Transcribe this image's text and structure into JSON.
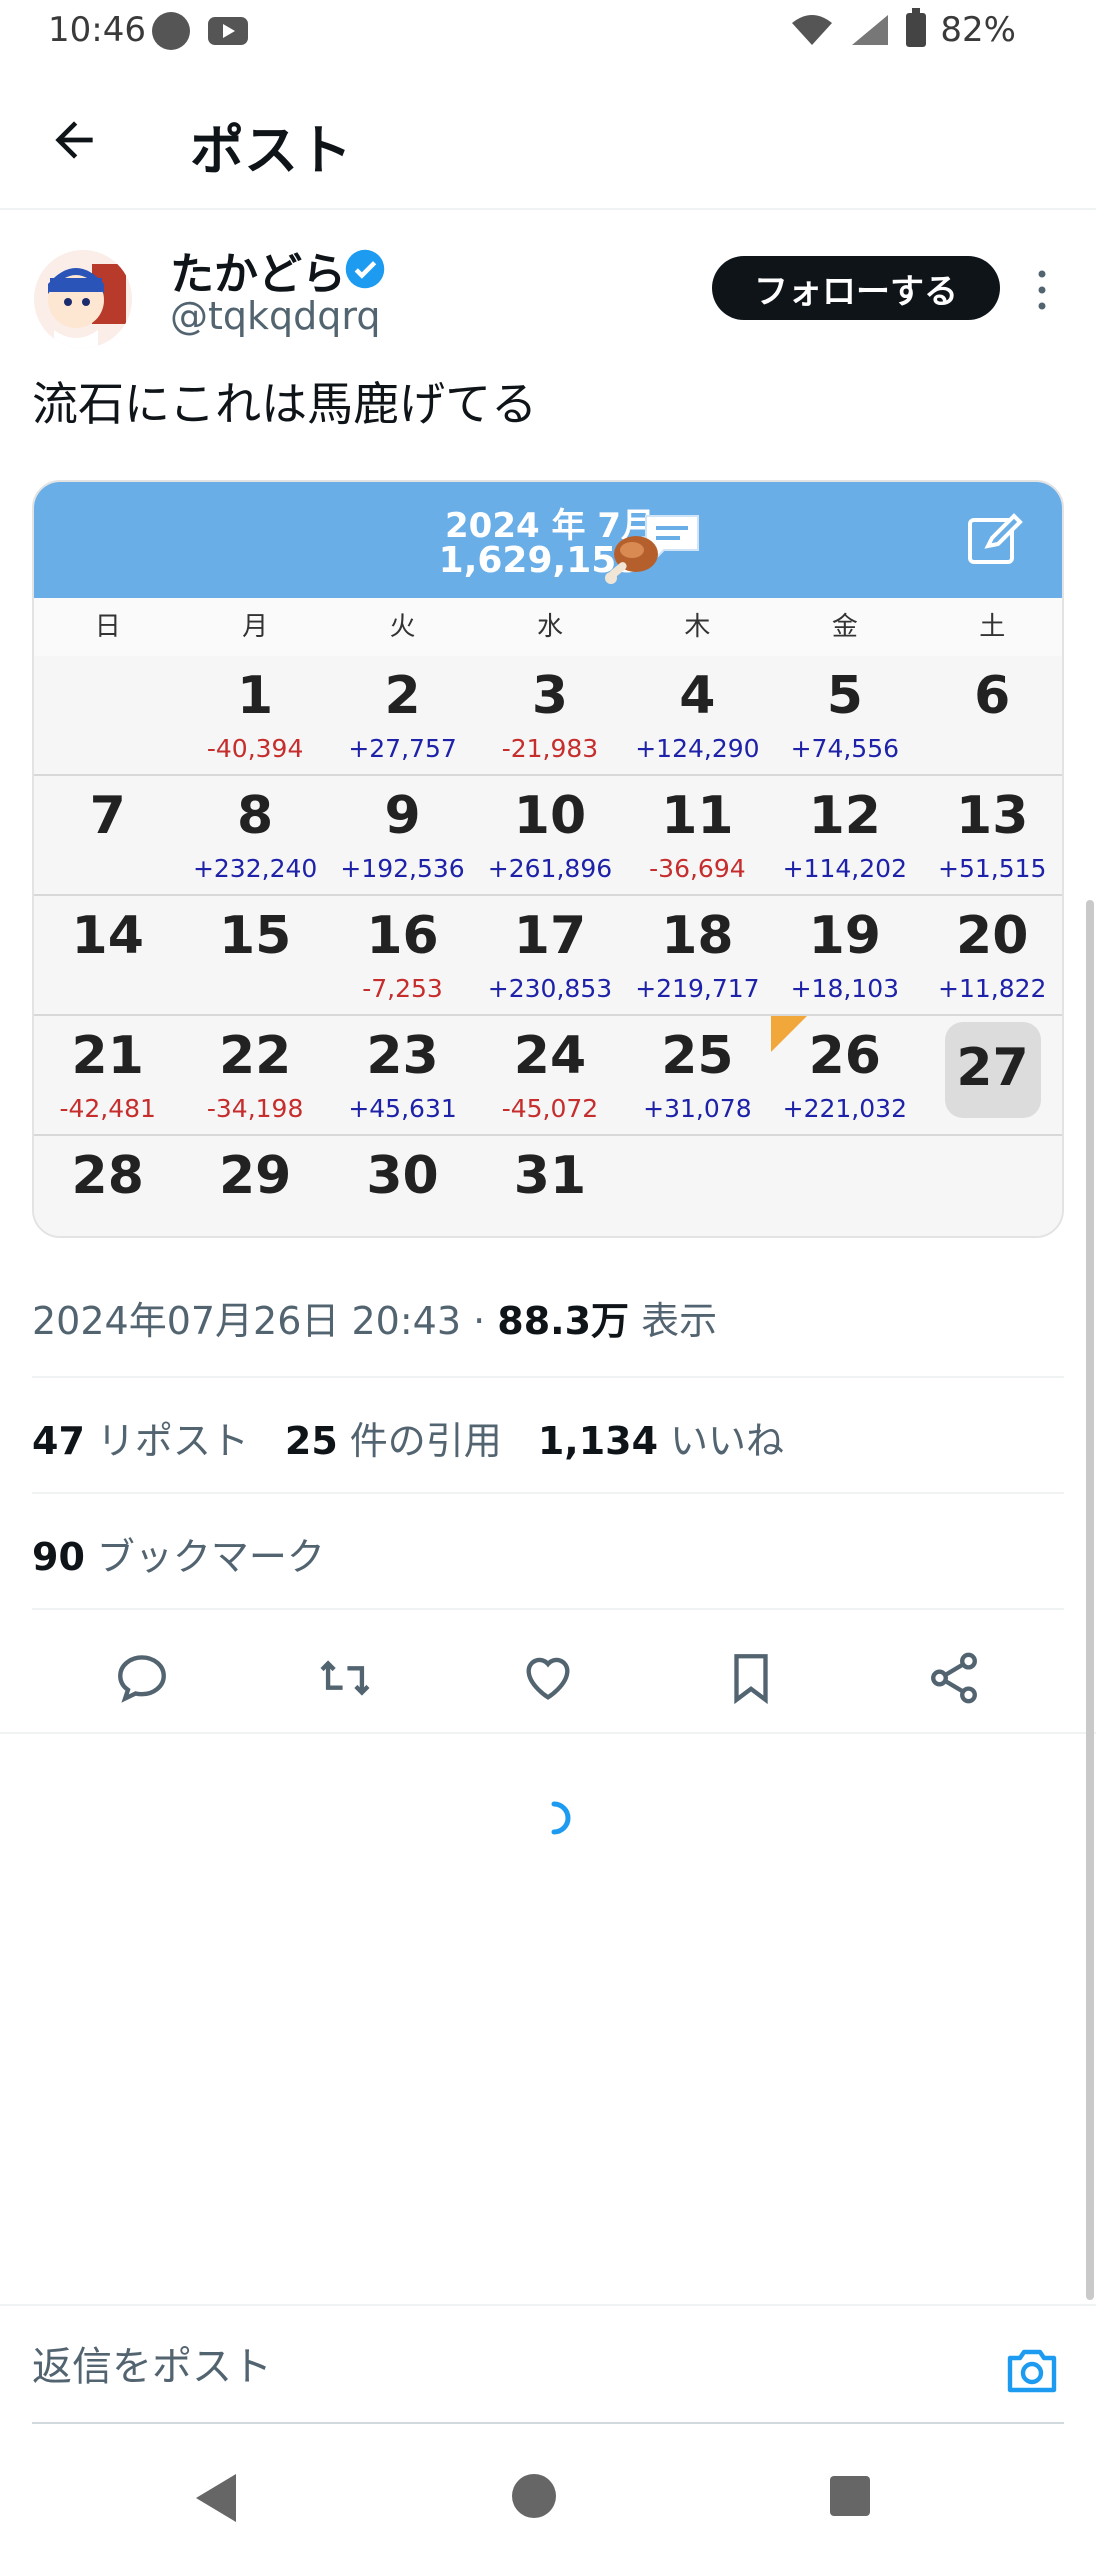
{
  "status_bar": {
    "time": "10:46",
    "battery": "82%"
  },
  "header": {
    "title": "ポスト"
  },
  "author": {
    "name": "たかどら",
    "handle": "@tqkqdqrq",
    "follow_label": "フォローする"
  },
  "post": {
    "text": "流石にこれは馬鹿げてる"
  },
  "calendar": {
    "title": "2024 年 7月",
    "total": "1,629,153",
    "weekdays": [
      "日",
      "月",
      "火",
      "水",
      "木",
      "金",
      "土"
    ],
    "weeks": [
      [
        {
          "day": "",
          "delta": ""
        },
        {
          "day": "1",
          "delta": "-40,394"
        },
        {
          "day": "2",
          "delta": "+27,757"
        },
        {
          "day": "3",
          "delta": "-21,983"
        },
        {
          "day": "4",
          "delta": "+124,290"
        },
        {
          "day": "5",
          "delta": "+74,556"
        },
        {
          "day": "6",
          "delta": ""
        }
      ],
      [
        {
          "day": "7",
          "delta": ""
        },
        {
          "day": "8",
          "delta": "+232,240"
        },
        {
          "day": "9",
          "delta": "+192,536"
        },
        {
          "day": "10",
          "delta": "+261,896"
        },
        {
          "day": "11",
          "delta": "-36,694"
        },
        {
          "day": "12",
          "delta": "+114,202"
        },
        {
          "day": "13",
          "delta": "+51,515"
        }
      ],
      [
        {
          "day": "14",
          "delta": ""
        },
        {
          "day": "15",
          "delta": ""
        },
        {
          "day": "16",
          "delta": "-7,253"
        },
        {
          "day": "17",
          "delta": "+230,853"
        },
        {
          "day": "18",
          "delta": "+219,717"
        },
        {
          "day": "19",
          "delta": "+18,103"
        },
        {
          "day": "20",
          "delta": "+11,822"
        }
      ],
      [
        {
          "day": "21",
          "delta": "-42,481"
        },
        {
          "day": "22",
          "delta": "-34,198"
        },
        {
          "day": "23",
          "delta": "+45,631"
        },
        {
          "day": "24",
          "delta": "-45,072"
        },
        {
          "day": "25",
          "delta": "+31,078"
        },
        {
          "day": "26",
          "delta": "+221,032",
          "flag": true
        },
        {
          "day": "27",
          "delta": "",
          "today": true
        }
      ],
      [
        {
          "day": "28",
          "delta": ""
        },
        {
          "day": "29",
          "delta": ""
        },
        {
          "day": "30",
          "delta": ""
        },
        {
          "day": "31",
          "delta": ""
        },
        {
          "day": "",
          "delta": ""
        },
        {
          "day": "",
          "delta": ""
        },
        {
          "day": "",
          "delta": ""
        }
      ]
    ],
    "colors": {
      "header": "#6aaee8",
      "positive": "#1e22a8",
      "negative": "#c62d2d",
      "flag": "#f2a73b"
    }
  },
  "meta": {
    "datetime": "2024年07月26日 20:43",
    "separator": "·",
    "views": "88.3万",
    "views_label": "表示"
  },
  "stats": {
    "reposts": "47",
    "reposts_label": "リポスト",
    "quotes": "25",
    "quotes_label": "件の引用",
    "likes": "1,134",
    "likes_label": "いいね",
    "bookmarks": "90",
    "bookmarks_label": "ブックマーク"
  },
  "actions": [
    "reply-icon",
    "repost-icon",
    "like-icon",
    "bookmark-icon",
    "share-icon"
  ],
  "reply": {
    "placeholder": "返信をポスト"
  },
  "accent_color": "#1d9bf0"
}
